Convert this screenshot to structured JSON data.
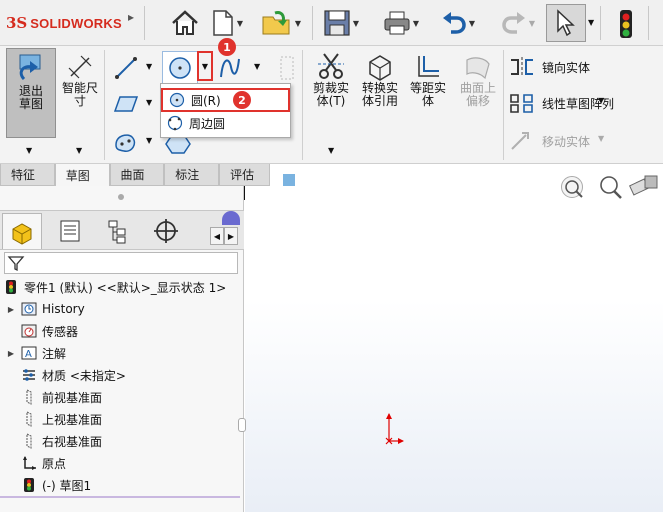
{
  "app": {
    "brand": "SOLIDWORKS",
    "brand_mark": "3S"
  },
  "ribbon": {
    "exit_sketch": "退出草图",
    "smart_dimension": "智能尺寸",
    "trim_entities": "剪裁实体(T)",
    "convert_entities": "转换实体引用",
    "offset_entities": "等距实体",
    "offset_surface": "曲面上偏移",
    "mirror_entities": "镜向实体",
    "linear_pattern": "线性草图阵列",
    "move_entities": "移动实体"
  },
  "dropdown": {
    "items": [
      {
        "label": "圆(R)"
      },
      {
        "label": "周边圆"
      }
    ]
  },
  "badges": [
    "1",
    "2"
  ],
  "tabs": [
    {
      "label": "特征"
    },
    {
      "label": "草图"
    },
    {
      "label": "曲面"
    },
    {
      "label": "标注"
    },
    {
      "label": "评估"
    }
  ],
  "tree": {
    "root": "零件1 (默认) <<默认>_显示状态 1>",
    "items": [
      {
        "label": "History",
        "icon": "history-icon"
      },
      {
        "label": "传感器",
        "icon": "sensor-icon"
      },
      {
        "label": "注解",
        "icon": "annotation-icon"
      },
      {
        "label": "材质 <未指定>",
        "icon": "material-icon"
      },
      {
        "label": "前视基准面",
        "icon": "plane-icon"
      },
      {
        "label": "上视基准面",
        "icon": "plane-icon"
      },
      {
        "label": "右视基准面",
        "icon": "plane-icon"
      },
      {
        "label": "原点",
        "icon": "origin-icon"
      },
      {
        "label": "(-) 草图1",
        "icon": "sketch-icon"
      }
    ]
  },
  "colors": {
    "accent_red": "#e0332d",
    "brand_red": "#d52b1e",
    "origin_red": "#e00000"
  }
}
